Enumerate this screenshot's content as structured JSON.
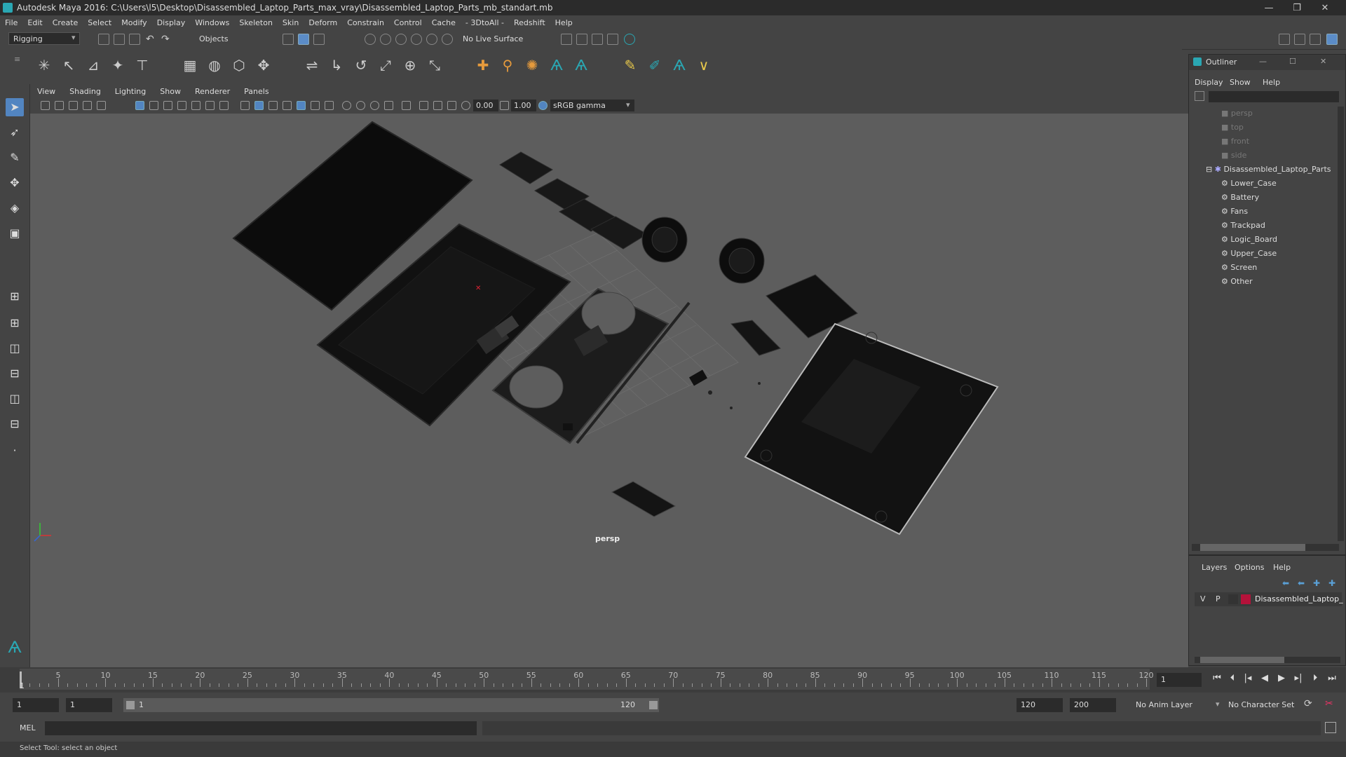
{
  "window": {
    "title": "Autodesk Maya 2016: C:\\Users\\l5\\Desktop\\Disassembled_Laptop_Parts_max_vray\\Disassembled_Laptop_Parts_mb_standart.mb",
    "minimize": "—",
    "restore": "❐",
    "close": "✕"
  },
  "menubar": [
    "File",
    "Edit",
    "Create",
    "Select",
    "Modify",
    "Display",
    "Windows",
    "Skeleton",
    "Skin",
    "Deform",
    "Constrain",
    "Control",
    "Cache",
    "- 3DtoAll -",
    "Redshift",
    "Help"
  ],
  "statusline": {
    "menuset": "Rigging",
    "selection_mode": "Objects",
    "live_surface": "No Live Surface"
  },
  "panel": {
    "menus": [
      "View",
      "Shading",
      "Lighting",
      "Show",
      "Renderer",
      "Panels"
    ],
    "near_value": "0.00",
    "far_value": "1.00",
    "color_space": "sRGB gamma",
    "camera_label": "persp"
  },
  "outliner": {
    "title": "Outliner",
    "menus": [
      "Display",
      "Show",
      "Help"
    ],
    "cameras": [
      "persp",
      "top",
      "front",
      "side"
    ],
    "root": "Disassembled_Laptop_Parts",
    "children": [
      "Lower_Case",
      "Battery",
      "Fans",
      "Trackpad",
      "Logic_Board",
      "Upper_Case",
      "Screen",
      "Other"
    ]
  },
  "layers": {
    "menus": [
      "Layers",
      "Options",
      "Help"
    ],
    "row": {
      "v": "V",
      "p": "P",
      "name": "Disassembled_Laptop_",
      "color": "#b5123a"
    }
  },
  "timeslider": {
    "ticks": [
      5,
      10,
      15,
      20,
      25,
      30,
      35,
      40,
      45,
      50,
      55,
      60,
      65,
      70,
      75,
      80,
      85,
      90,
      95,
      100,
      105,
      110,
      115,
      120
    ],
    "current_frame": "1",
    "current_marker": "1"
  },
  "rangeslider": {
    "start": "1",
    "anim_start": "1",
    "range_start_label": "1",
    "range_end_label": "120",
    "anim_end": "120",
    "end": "200",
    "anim_layer": "No Anim Layer",
    "character_set": "No Character Set"
  },
  "cmdline": {
    "label": "MEL"
  },
  "helpline": {
    "text": "Select Tool: select an object"
  },
  "colors": {
    "viewport_bg": "#5d5d5d",
    "selected_tool": "#5285c1",
    "maya_teal": "#2aa7b3"
  }
}
